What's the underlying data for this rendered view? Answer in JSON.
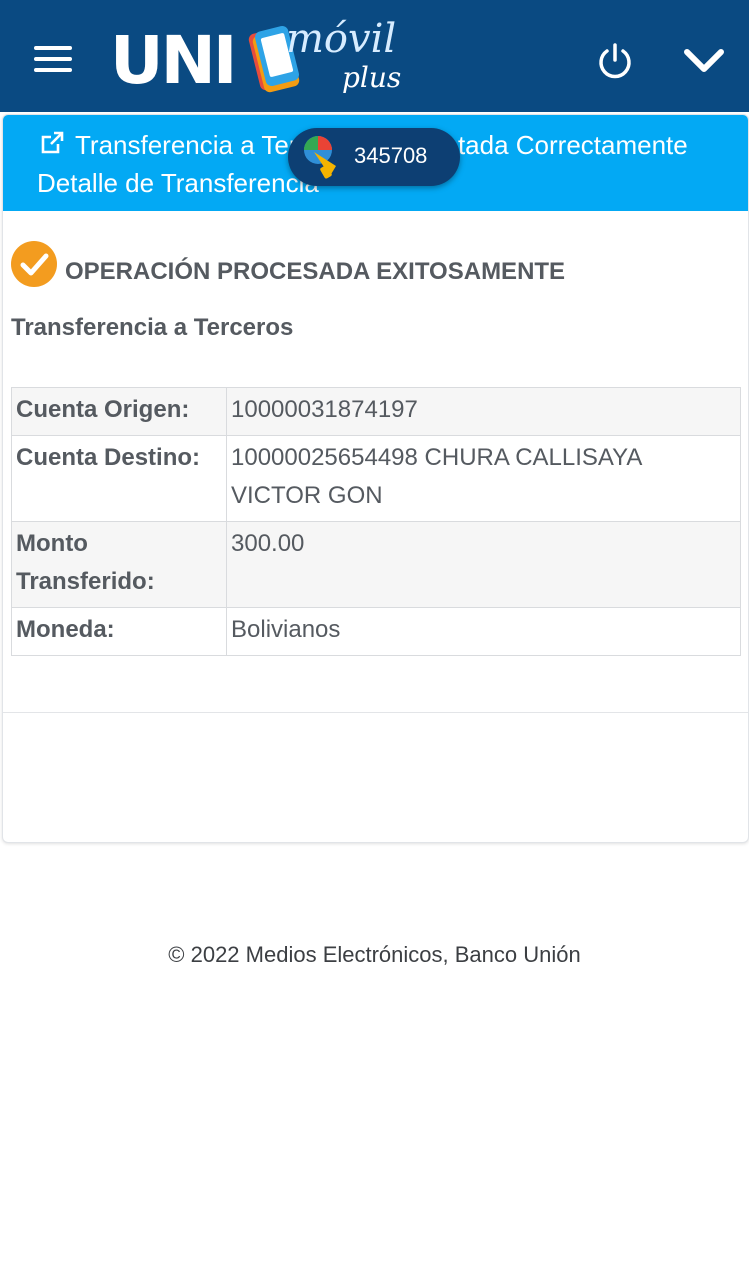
{
  "header": {
    "logo_text": "UNI",
    "logo_movil": "móvil",
    "logo_plus": "plus"
  },
  "panel": {
    "heading": "Transferencia a Terceros Completada Correctamente",
    "subheading": "Detalle de Transferencia"
  },
  "overlay_badge": {
    "value": "345708"
  },
  "result": {
    "status": "OPERACIÓN PROCESADA EXITOSAMENTE",
    "title": "Transferencia a Terceros"
  },
  "details": [
    {
      "label": "Cuenta Origen:",
      "value": "10000031874197"
    },
    {
      "label": "Cuenta Destino:",
      "value": "10000025654498 CHURA CALLISAYA VICTOR GON"
    },
    {
      "label": "Monto Transferido:",
      "value": "300.00"
    },
    {
      "label": "Moneda:",
      "value": "Bolivianos"
    }
  ],
  "footer": {
    "copyright": "© 2022 Medios Electrónicos, Banco Unión"
  },
  "colors": {
    "topbar": "#0a4a82",
    "panel_header": "#03a9f4",
    "success_check": "#f39c1f",
    "badge": "#0d3f73"
  }
}
